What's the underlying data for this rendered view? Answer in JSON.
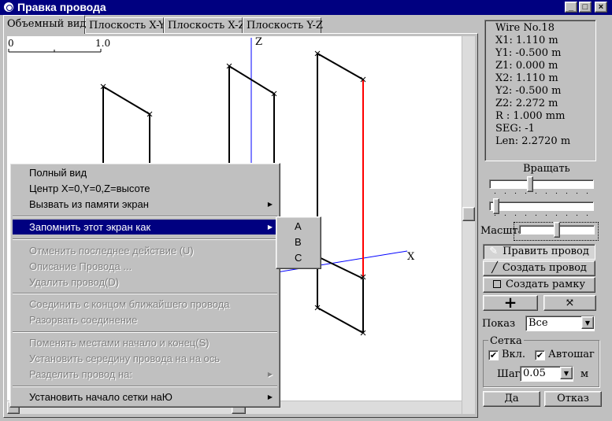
{
  "window": {
    "title": "Правка провода",
    "min_glyph": "_",
    "max_glyph": "□",
    "close_glyph": "×"
  },
  "tabs": [
    {
      "label": "Объемный вид",
      "active": true
    },
    {
      "label": "Плоскость X-Y",
      "active": false
    },
    {
      "label": "Плоскость X-Z",
      "active": false
    },
    {
      "label": "Плоскость Y-Z",
      "active": false
    }
  ],
  "viewport": {
    "scale_start": "0",
    "scale_end": "1.0",
    "axis_x_label": "X",
    "axis_z_label": "Z",
    "axis_color": "#0000ff",
    "selected_wire_color": "#ff0000"
  },
  "context_menu": {
    "items": [
      {
        "label": "Полный вид"
      },
      {
        "label": "Центр X=0,Y=0,Z=высоте"
      },
      {
        "label": "Вызвать из памяти экран",
        "submenu": true
      },
      {
        "label": "Запомнить этот экран как",
        "submenu": true,
        "selected": true
      },
      {
        "label": "Отменить последнее действие (U)",
        "disabled": true
      },
      {
        "label": "Описание Провода ...",
        "disabled": true
      },
      {
        "label": "Удалить провод(D)",
        "disabled": true
      },
      {
        "label": "Соединить с концом ближайшего провода",
        "disabled": true
      },
      {
        "label": "Разорвать соединение",
        "disabled": true
      },
      {
        "label": "Поменять местами начало и конец(S)",
        "disabled": true
      },
      {
        "label": "Установить середину провода на на ось",
        "disabled": true
      },
      {
        "label": "Разделить провод на:",
        "disabled": true,
        "submenu": true
      },
      {
        "label": "Установить начало сетки наЮ",
        "submenu": true
      }
    ],
    "submenu_items": [
      "A",
      "B",
      "C"
    ]
  },
  "wire_info": {
    "lines": [
      "Wire No.18",
      "X1: 1.110 m",
      "Y1: -0.500 m",
      "Z1: 0.000 m",
      "X2: 1.110 m",
      "Y2: -0.500 m",
      "Z2: 2.272 m",
      "R : 1.000 mm",
      "SEG: -1",
      "Len: 2.2720 m"
    ]
  },
  "controls": {
    "rotate_label": "Вращать",
    "rotate_h_value": 0.38,
    "rotate_v_value": 0.04,
    "scale_label": "Масштаб",
    "edit_wire_label": "Править провод",
    "create_wire_label": "Создать провод",
    "create_frame_label": "Создать рамку",
    "plus_glyph": "+",
    "show_label": "Показ",
    "show_value": "Все",
    "grid_label": "Сетка",
    "grid_on_label": "Вкл.",
    "grid_on_checked": true,
    "autostep_label": "Автошаг",
    "autostep_checked": true,
    "step_label": "Шаг",
    "step_value": "0.05",
    "step_unit": "м",
    "ok_label": "Да",
    "cancel_label": "Отказ"
  }
}
